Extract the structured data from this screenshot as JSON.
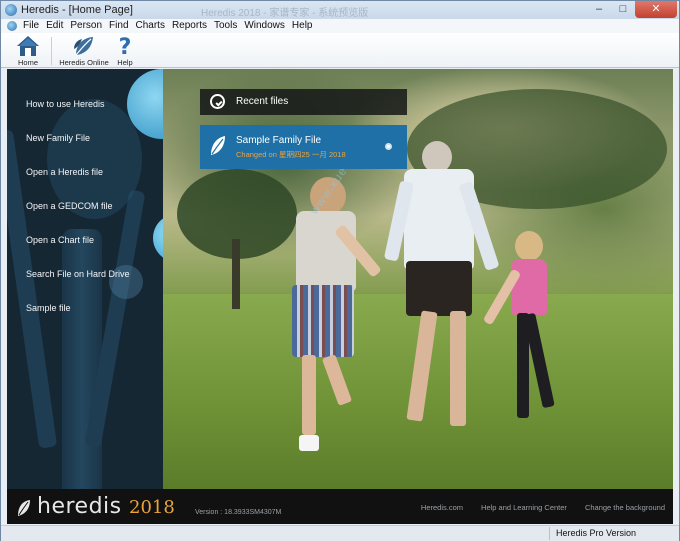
{
  "window": {
    "title": "Heredis - [Home Page]",
    "title_ghost": "Heredis 2018 - 家谱专家 - 系统预览版",
    "controls": {
      "minimize": "–",
      "maximize": "□",
      "close": "✕"
    }
  },
  "menu": {
    "items": [
      "File",
      "Edit",
      "Person",
      "Find",
      "Charts",
      "Reports",
      "Tools",
      "Windows",
      "Help"
    ]
  },
  "toolbar": {
    "home_label": "Home",
    "online_label": "Heredis Online",
    "help_label": "Help"
  },
  "sidebar": {
    "items": [
      {
        "label": "How to use Heredis"
      },
      {
        "label": "New Family File"
      },
      {
        "label": "Open a Heredis file"
      },
      {
        "label": "Open a GEDCOM file"
      },
      {
        "label": "Open a Chart file"
      },
      {
        "label": "Search File on Hard Drive"
      },
      {
        "label": "Sample file"
      }
    ]
  },
  "recent": {
    "header": "Recent files",
    "items": [
      {
        "name": "Sample Family File",
        "changed": "Changed on 星期四25 一月 2018"
      }
    ]
  },
  "watermark": "www.xue51.com",
  "footer": {
    "logo_text": "heredis",
    "logo_year": "2018",
    "version": "Version : 18.3933SM4307M",
    "links": [
      "Heredis.com",
      "Help and Learning Center",
      "Change the background"
    ]
  },
  "status": {
    "edition": "Heredis Pro Version"
  },
  "colors": {
    "accent": "#1f70a6",
    "changed_text": "#f0a23b",
    "sidebar_bg": "#162734"
  }
}
